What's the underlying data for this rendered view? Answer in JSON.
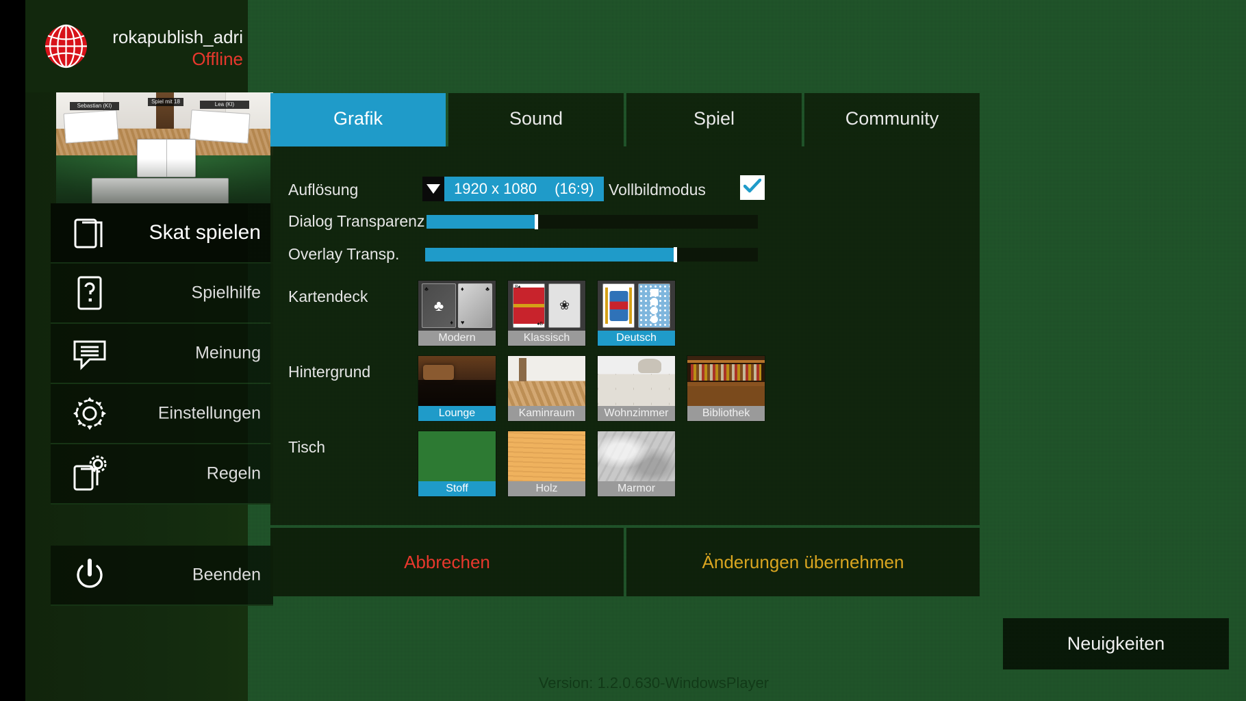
{
  "profile": {
    "name": "rokapublish_adri",
    "status": "Offline",
    "globe_icon": "globe-icon",
    "globe_color": "#d8121a"
  },
  "sidebar": {
    "items": [
      {
        "label": "Skat spielen",
        "icon": "cards-icon",
        "active": true
      },
      {
        "label": "Spielhilfe",
        "icon": "question-card-icon",
        "active": false
      },
      {
        "label": "Meinung",
        "icon": "speech-bubble-icon",
        "active": false
      },
      {
        "label": "Einstellungen",
        "icon": "gear-icon",
        "active": false
      },
      {
        "label": "Regeln",
        "icon": "card-gear-icon",
        "active": false
      }
    ],
    "exit": {
      "label": "Beenden",
      "icon": "power-icon"
    }
  },
  "settings": {
    "tabs": [
      {
        "label": "Grafik",
        "active": true
      },
      {
        "label": "Sound",
        "active": false
      },
      {
        "label": "Spiel",
        "active": false
      },
      {
        "label": "Community",
        "active": false
      }
    ],
    "resolution": {
      "label": "Auflösung",
      "value": "1920 x 1080",
      "aspect": "(16:9)",
      "arrow_icon": "chevron-down-icon"
    },
    "fullscreen": {
      "label": "Vollbildmodus",
      "checked": true,
      "check_icon": "checkmark-icon"
    },
    "sliders": [
      {
        "label": "Dialog Transparenz",
        "value": 33
      },
      {
        "label": "Overlay Transp.",
        "value": 75
      }
    ],
    "deck": {
      "label": "Kartendeck",
      "options": [
        {
          "label": "Modern",
          "selected": false,
          "art": "modern"
        },
        {
          "label": "Klassisch",
          "selected": false,
          "art": "classic"
        },
        {
          "label": "Deutsch",
          "selected": true,
          "art": "german"
        }
      ]
    },
    "background": {
      "label": "Hintergrund",
      "options": [
        {
          "label": "Lounge",
          "selected": true,
          "art": "lounge"
        },
        {
          "label": "Kaminraum",
          "selected": false,
          "art": "kamin"
        },
        {
          "label": "Wohnzimmer",
          "selected": false,
          "art": "wohn"
        },
        {
          "label": "Bibliothek",
          "selected": false,
          "art": "biblio"
        }
      ]
    },
    "table": {
      "label": "Tisch",
      "options": [
        {
          "label": "Stoff",
          "selected": true,
          "art": "stoff"
        },
        {
          "label": "Holz",
          "selected": false,
          "art": "holz"
        },
        {
          "label": "Marmor",
          "selected": false,
          "art": "marmor"
        }
      ]
    },
    "footer": {
      "cancel": "Abbrechen",
      "apply": "Änderungen übernehmen"
    }
  },
  "news_button": {
    "label": "Neuigkeiten"
  },
  "version": "Version: 1.2.0.630-WindowsPlayer",
  "preview": {
    "player_left": "Sebastian (KI)",
    "player_center": "Spiel mit 18",
    "player_right": "Lea (KI)"
  },
  "colors": {
    "accent_blue": "#1f9bc9",
    "felt_green": "#1d5427",
    "panel_dark": "#16290f",
    "red": "#e8382d",
    "orange": "#d9a520"
  }
}
